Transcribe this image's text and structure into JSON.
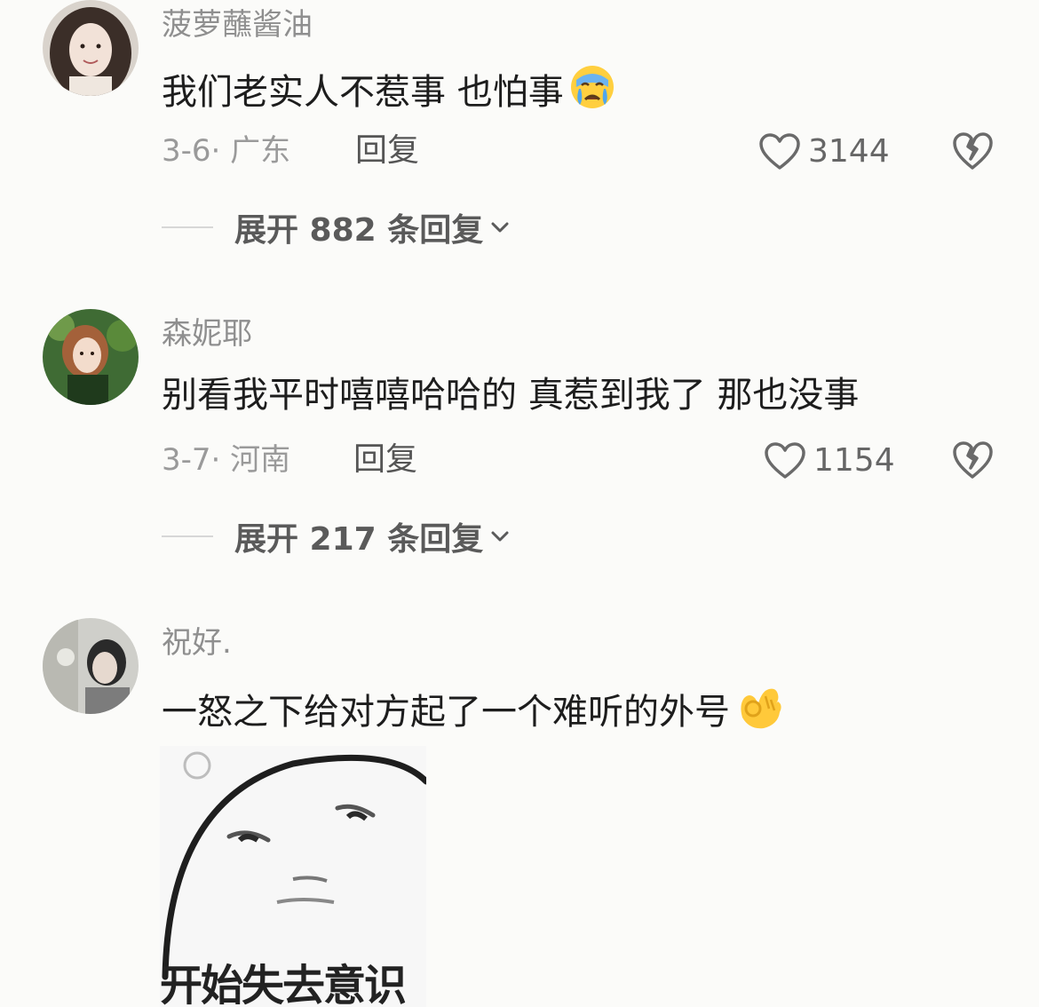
{
  "comments": [
    {
      "username": "菠萝蘸酱油",
      "text": "我们老实人不惹事 也怕事",
      "emoji": "crying-face-emoji",
      "date": "3-6",
      "location": "广东",
      "reply_label": "回复",
      "likes": "3144",
      "expand_label": "展开 882 条回复"
    },
    {
      "username": "森妮耶",
      "text": "别看我平时嘻嘻哈哈的 真惹到我了 那也没事",
      "date": "3-7",
      "location": "河南",
      "reply_label": "回复",
      "likes": "1154",
      "expand_label": "展开 217 条回复"
    },
    {
      "username": "祝好.",
      "text": "一怒之下给对方起了一个难听的外号",
      "emoji": "ok-hand-emoji",
      "sticker_caption": "开始失去意识"
    }
  ],
  "colors": {
    "background": "#fbfbf9",
    "username": "#8f8f8f",
    "meta": "#9a9a9a",
    "text": "#1d1d1d"
  }
}
